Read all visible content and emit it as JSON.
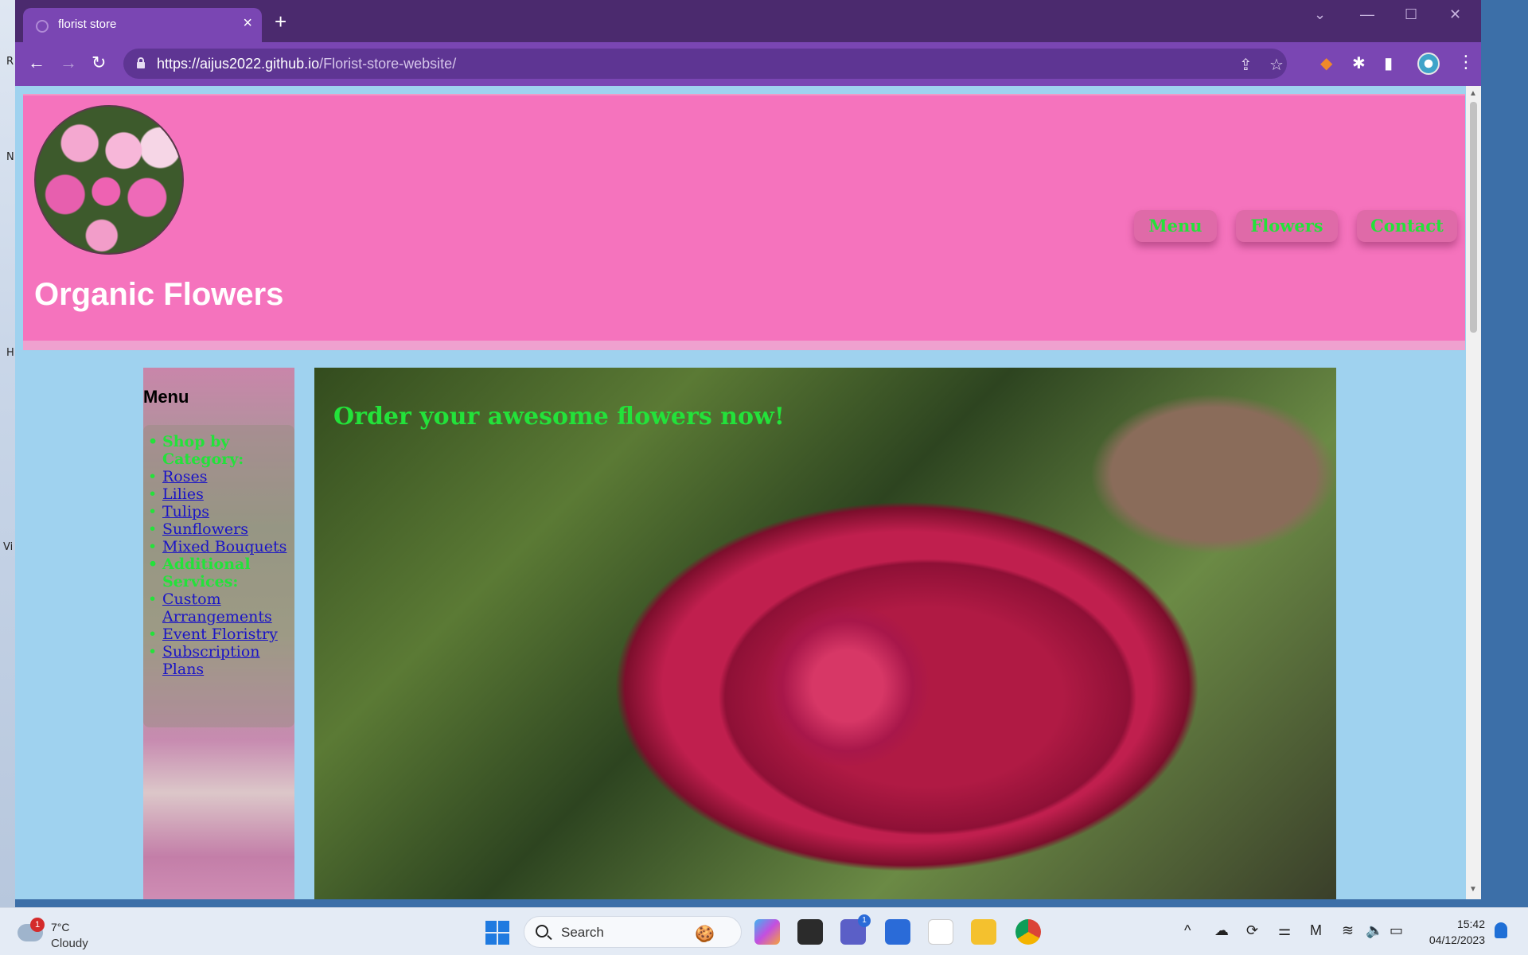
{
  "browser": {
    "tab_title": "florist store",
    "url_host": "https://aijus2022.github.io",
    "url_path": "/Florist-store-website/"
  },
  "site": {
    "title": "Organic Flowers",
    "nav": [
      "Menu",
      "Flowers",
      "Contact"
    ],
    "sidebar": {
      "heading": "Menu",
      "items": [
        {
          "text": "Shop by Category:",
          "type": "category"
        },
        {
          "text": "Roses",
          "type": "link"
        },
        {
          "text": "Lilies",
          "type": "link"
        },
        {
          "text": "Tulips",
          "type": "link"
        },
        {
          "text": "Sunflowers",
          "type": "link"
        },
        {
          "text": "Mixed Bouquets",
          "type": "link"
        },
        {
          "text": "Additional Services:",
          "type": "category"
        },
        {
          "text": "Custom Arrangements",
          "type": "link"
        },
        {
          "text": "Event Floristry",
          "type": "link"
        },
        {
          "text": "Subscription Plans",
          "type": "link"
        }
      ]
    },
    "hero_tagline": "Order your awesome flowers now!",
    "colors": {
      "accent_green": "#23e23a",
      "header_pink": "#f573bd",
      "page_blue": "#9fd2ef",
      "link_blue": "#1a14c6"
    }
  },
  "taskbar": {
    "weather_badge": "1",
    "weather_temp": "7°C",
    "weather_condition": "Cloudy",
    "search_label": "Search",
    "teams_badge": "1",
    "time": "15:42",
    "date": "04/12/2023"
  },
  "desktop_edge": [
    "R",
    "N",
    "H",
    "Vi"
  ]
}
